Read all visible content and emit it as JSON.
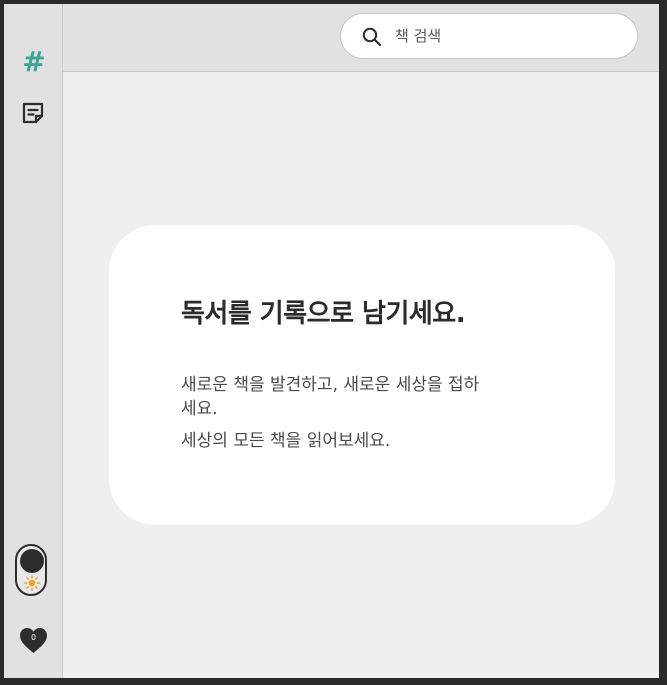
{
  "sidebar": {
    "icons": [
      "hashtag-icon",
      "note-icon"
    ],
    "theme_toggle": {
      "state": "light",
      "icon": "sun-icon"
    },
    "heart": {
      "icon": "heart-icon",
      "count": "0"
    }
  },
  "search": {
    "placeholder": "책 검색",
    "value": ""
  },
  "card": {
    "title": "독서를 기록으로 남기세요.",
    "line1": "새로운 책을 발견하고, 새로운 세상을 접하세요.",
    "line2": "세상의 모든 책을 읽어보세요."
  },
  "colors": {
    "accent": "#3aa597",
    "sun": "#f0a020",
    "dark": "#2d2d2d"
  }
}
